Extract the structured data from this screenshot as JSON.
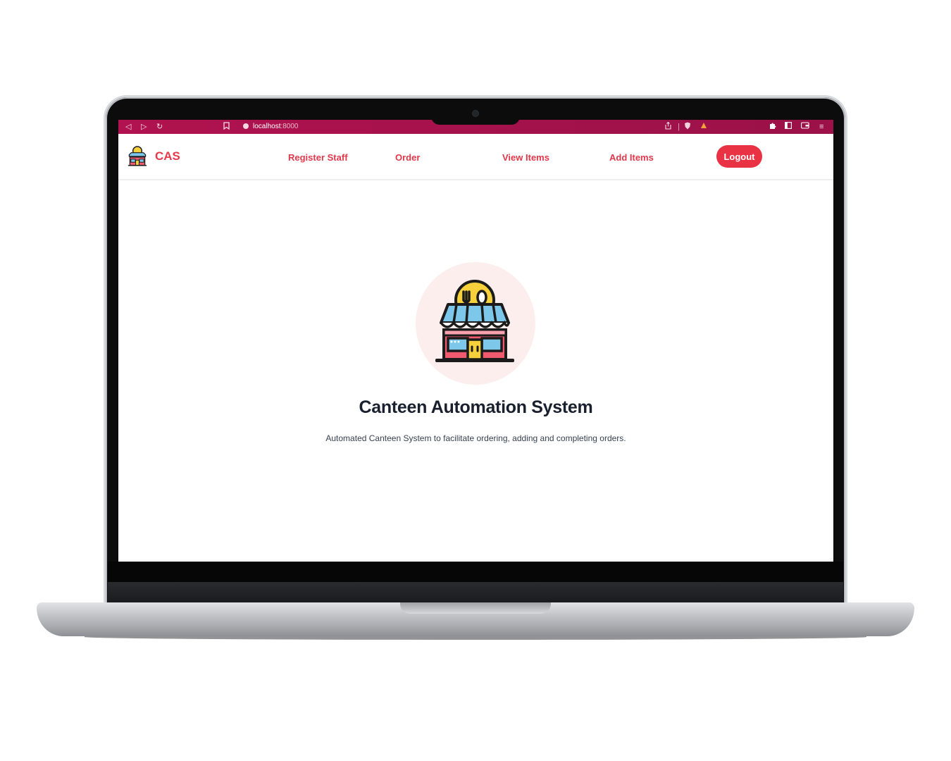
{
  "browser": {
    "url_host": "localhost",
    "url_port": ":8000",
    "icons": [
      "back-icon",
      "forward-icon",
      "reload-icon",
      "bookmark-icon",
      "site-info-icon",
      "share-icon",
      "brave-shield-icon",
      "rewards-icon",
      "extensions-icon",
      "sidebar-icon",
      "wallet-icon",
      "menu-icon"
    ],
    "accent": "#a8124c"
  },
  "nav": {
    "brand": "CAS",
    "links": [
      "Register Staff",
      "Order",
      "View Items",
      "Add Items"
    ],
    "logout": "Logout",
    "accent": "#e8394b"
  },
  "hero": {
    "icon": "canteen-store-icon",
    "title": "Canteen Automation System",
    "subtitle": "Automated Canteen System to facilitate ordering, adding and completing orders."
  }
}
